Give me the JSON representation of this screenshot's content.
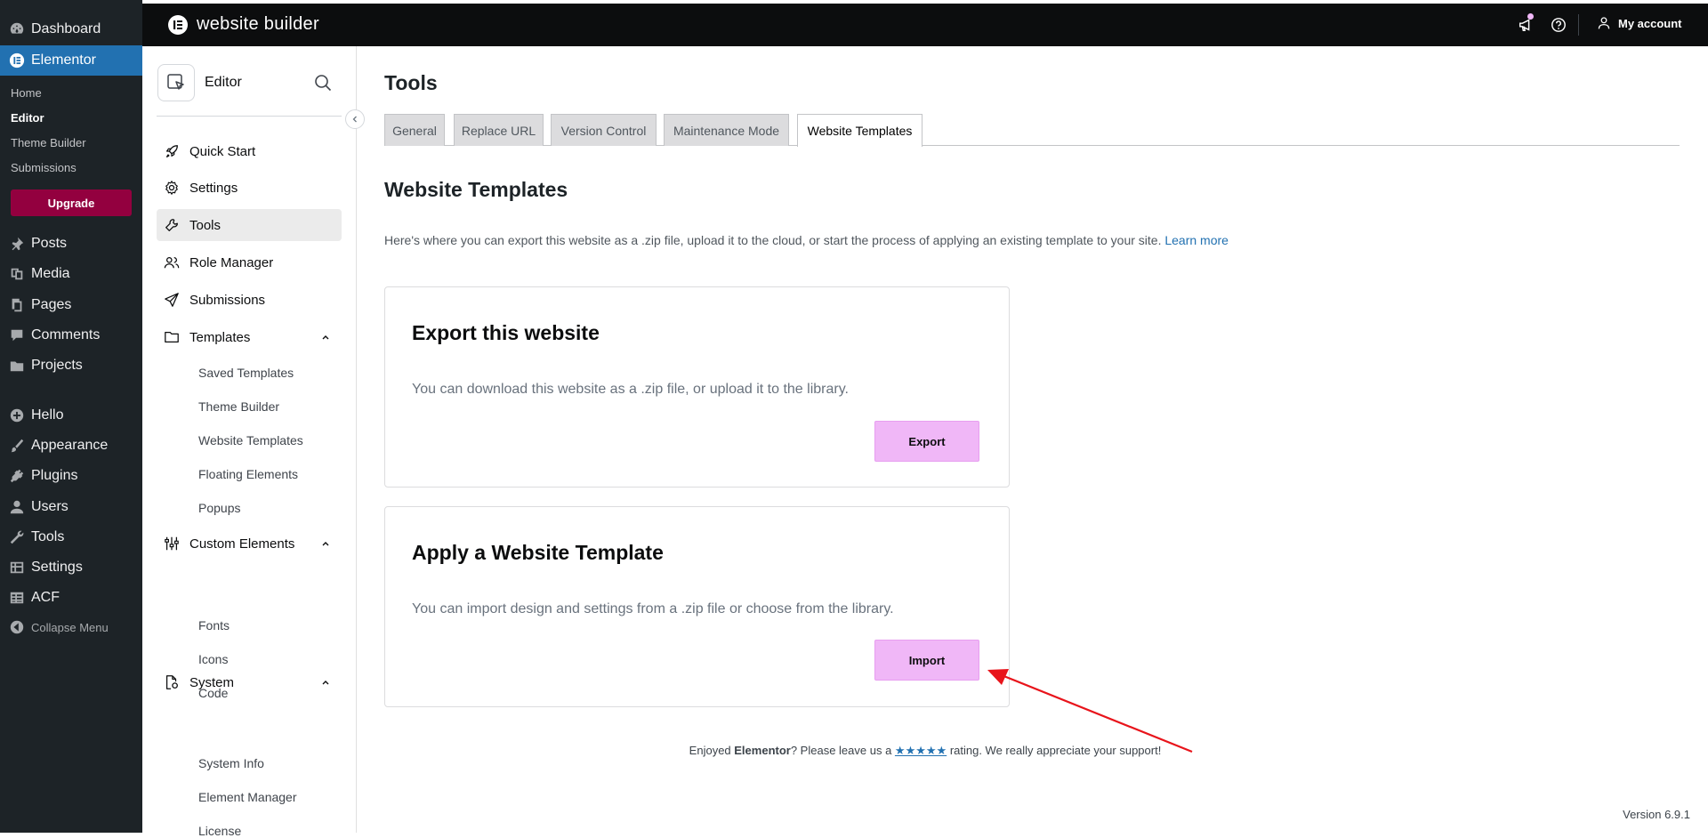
{
  "wp_menu": {
    "items": [
      {
        "label": "Dashboard",
        "icon": "dashboard-icon"
      },
      {
        "label": "Elementor",
        "icon": "elementor-icon"
      },
      {
        "label": "Posts",
        "icon": "pin-icon"
      },
      {
        "label": "Media",
        "icon": "media-icon"
      },
      {
        "label": "Pages",
        "icon": "pages-icon"
      },
      {
        "label": "Comments",
        "icon": "comment-icon"
      },
      {
        "label": "Projects",
        "icon": "folder-icon"
      },
      {
        "label": "Hello",
        "icon": "plus-circle-icon"
      },
      {
        "label": "Appearance",
        "icon": "brush-icon"
      },
      {
        "label": "Plugins",
        "icon": "plug-icon"
      },
      {
        "label": "Users",
        "icon": "user-icon"
      },
      {
        "label": "Tools",
        "icon": "wrench-icon"
      },
      {
        "label": "Settings",
        "icon": "settings-icon"
      },
      {
        "label": "ACF",
        "icon": "table-icon"
      }
    ],
    "elementor_sub": [
      "Home",
      "Editor",
      "Theme Builder",
      "Submissions"
    ],
    "upgrade": "Upgrade",
    "collapse": "Collapse Menu"
  },
  "topbar": {
    "title": "website builder",
    "account": "My account",
    "notification_color": "#f0b7f7"
  },
  "panel": {
    "title": "Editor",
    "items": [
      "Quick Start",
      "Settings",
      "Tools",
      "Role Manager",
      "Submissions"
    ],
    "templates": {
      "label": "Templates",
      "children": [
        "Saved Templates",
        "Theme Builder",
        "Website Templates",
        "Floating Elements",
        "Popups"
      ]
    },
    "custom_elements": {
      "label": "Custom Elements",
      "children": [
        "Fonts",
        "Icons",
        "Code"
      ]
    },
    "system": {
      "label": "System",
      "children": [
        "System Info",
        "Element Manager",
        "License"
      ]
    }
  },
  "main": {
    "title": "Tools",
    "tabs": [
      "General",
      "Replace URL",
      "Version Control",
      "Maintenance Mode",
      "Website Templates"
    ],
    "active_tab": "Website Templates",
    "section_title": "Website Templates",
    "intro": "Here's where you can export this website as a .zip file, upload it to the cloud, or start the process of applying an existing template to your site.",
    "learn_more": "Learn more",
    "export_card": {
      "title": "Export this website",
      "text": "You can download this website as a .zip file, or upload it to the library.",
      "button": "Export"
    },
    "import_card": {
      "title": "Apply a Website Template",
      "text": "You can import design and settings from a .zip file or choose from the library.",
      "button": "Import"
    }
  },
  "footer": {
    "pre": "Enjoyed ",
    "brand": "Elementor",
    "mid": "? Please leave us a ",
    "stars": "★★★★★",
    "post": " rating. We really appreciate your support!",
    "version": "Version 6.9.1"
  },
  "colors": {
    "accent": "#2271b1",
    "upgrade": "#93003f",
    "button": "#f0b7f7",
    "arrow": "#e8141b"
  }
}
